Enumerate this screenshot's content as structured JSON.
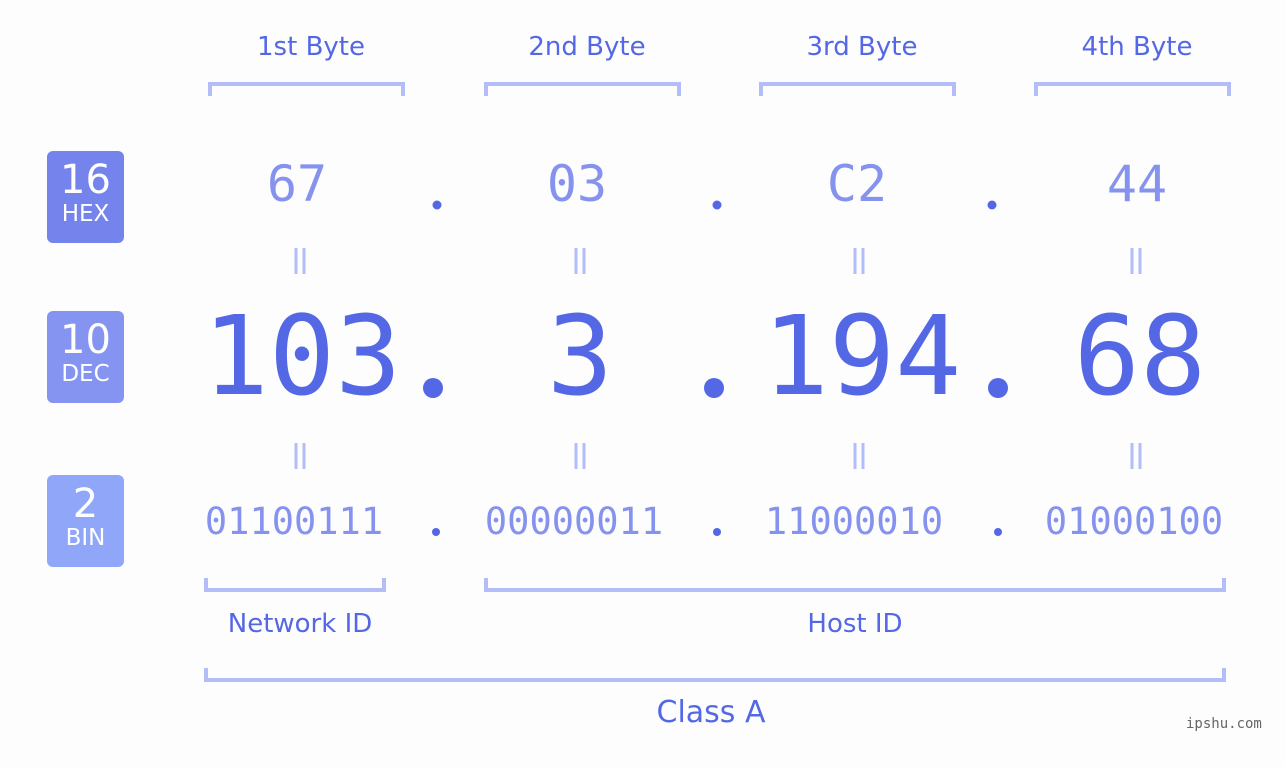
{
  "byte_headers": [
    "1st Byte",
    "2nd Byte",
    "3rd Byte",
    "4th Byte"
  ],
  "badges": {
    "hex": {
      "number": "16",
      "label": "HEX",
      "color": "#7584ec"
    },
    "dec": {
      "number": "10",
      "label": "DEC",
      "color": "#8594f1"
    },
    "bin": {
      "number": "2",
      "label": "BIN",
      "color": "#8fa6f9"
    }
  },
  "hex_values": [
    "67",
    "03",
    "C2",
    "44"
  ],
  "dec_values": [
    "103",
    "3",
    "194",
    "68"
  ],
  "bin_values": [
    "01100111",
    "00000011",
    "11000010",
    "01000100"
  ],
  "separator": ".",
  "network_id_label": "Network ID",
  "host_id_label": "Host ID",
  "class_label": "Class A",
  "watermark": "ipshu.com",
  "colors": {
    "primary": "#5468e6",
    "secondary": "#8592ee",
    "bracket": "#b3bdf8",
    "background": "#fcfdfc"
  }
}
